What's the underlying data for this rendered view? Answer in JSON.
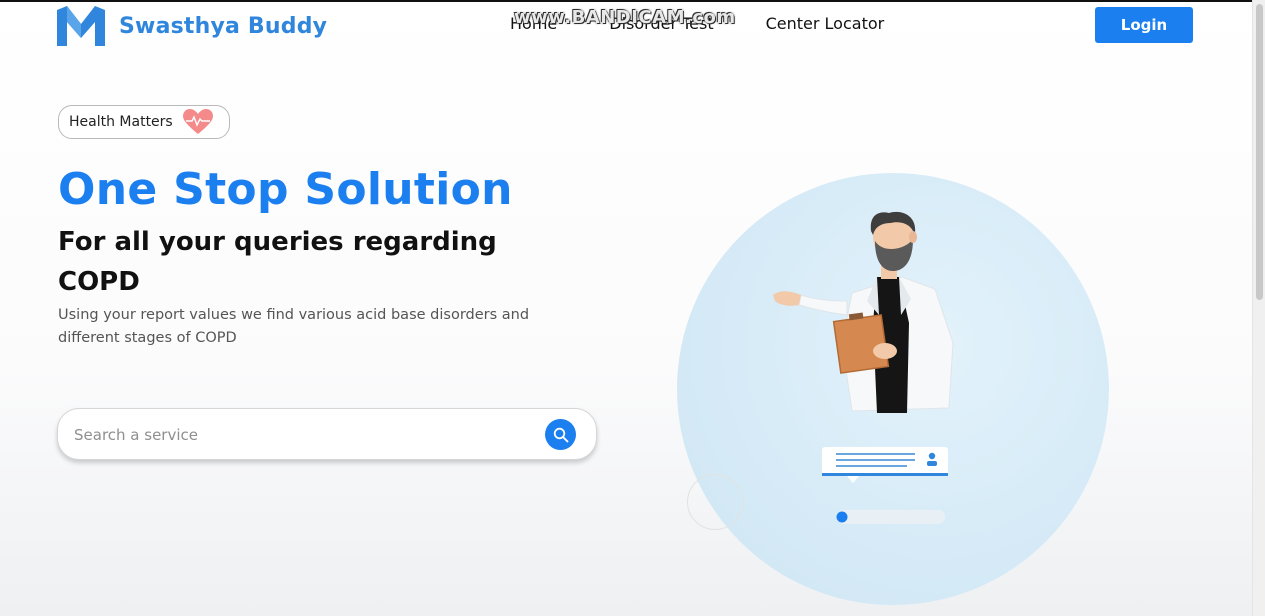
{
  "brand": {
    "name": "Swasthya Buddy",
    "icon": "m-logo-icon",
    "color": "#2f86dc"
  },
  "nav": {
    "items": [
      "Home",
      "Disorder Test",
      "Center Locator"
    ]
  },
  "header": {
    "login_label": "Login"
  },
  "hero": {
    "badge": "Health Matters",
    "title": "One Stop Solution",
    "subtitle": "For all your queries regarding COPD",
    "description": "Using your report values we find various acid base disorders and different stages of COPD"
  },
  "search": {
    "placeholder": "Search a service",
    "value": "",
    "icon": "search-icon"
  },
  "overlay": {
    "watermark": "www.BANDICAM.com"
  },
  "colors": {
    "accent": "#1b7ff0",
    "circle": "#d6ebf7",
    "heart": "#f06d6d"
  }
}
